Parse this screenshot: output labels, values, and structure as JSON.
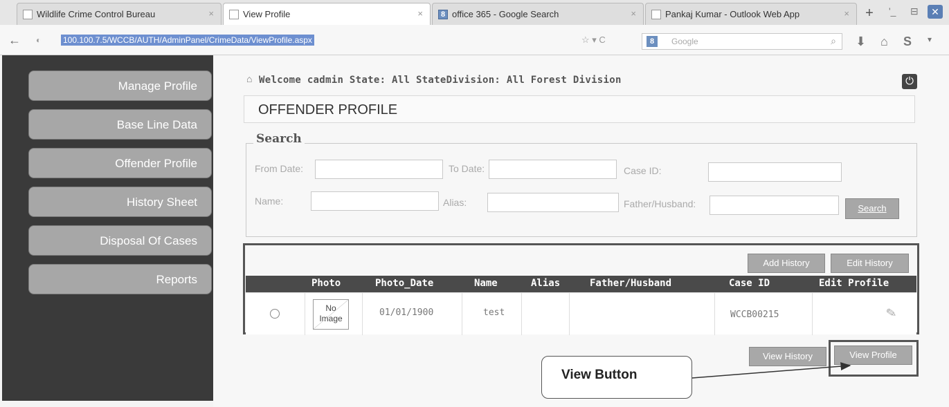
{
  "browser": {
    "tabs": [
      {
        "label": "Wildlife Crime Control Bureau",
        "close": "×"
      },
      {
        "label": "View Profile",
        "close": "×"
      },
      {
        "label": "office 365 - Google Search",
        "close": "×",
        "icon": "8"
      },
      {
        "label": "Pankaj Kumar - Outlook Web App",
        "close": "×"
      }
    ],
    "url": "100.100.7.5/WCCB/AUTH/AdminPanel/CrimeData/ViewProfile.aspx",
    "search_placeholder": "Google",
    "search_icon": "8"
  },
  "sidebar": {
    "items": [
      {
        "label": "Manage Profile"
      },
      {
        "label": "Base Line Data"
      },
      {
        "label": "Offender Profile"
      },
      {
        "label": "History Sheet"
      },
      {
        "label": "Disposal Of Cases"
      },
      {
        "label": "Reports"
      }
    ]
  },
  "header": {
    "welcome": "Welcome cadmin State: All StateDivision: All Forest Division",
    "title": "OFFENDER PROFILE"
  },
  "search": {
    "legend": "Search",
    "from_date_label": "From Date:",
    "to_date_label": "To Date:",
    "case_id_label": "Case ID:",
    "name_label": "Name:",
    "alias_label": "Alias:",
    "father_label": "Father/Husband:",
    "button": "Search"
  },
  "grid": {
    "add_history": "Add History",
    "edit_history": "Edit History",
    "columns": [
      "Photo",
      "Photo_Date",
      "Name",
      "Alias",
      "Father/Husband",
      "Case ID",
      "Edit Profile"
    ],
    "rows": [
      {
        "photo": "No Image",
        "photo_date": "01/01/1900",
        "name": "test",
        "alias": "",
        "father": "",
        "case_id": "WCCB00215"
      }
    ],
    "view_history": "View History",
    "view_profile": "View Profile"
  },
  "annotation": {
    "callout": "View Button"
  }
}
